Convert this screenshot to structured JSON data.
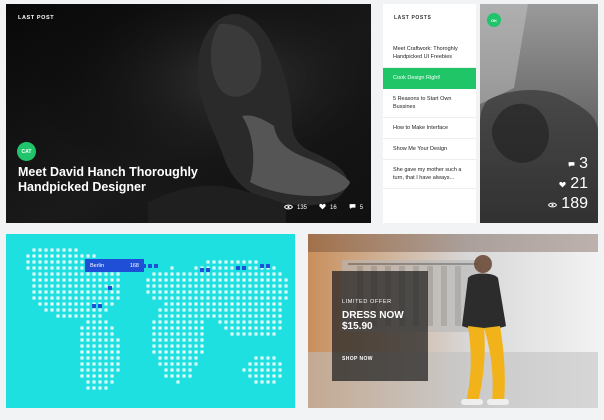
{
  "hero": {
    "kicker": "LAST POST",
    "category": "CAT",
    "title": "Meet David Hanch Thoroughly Handpicked Designer",
    "stats": {
      "views": "135",
      "likes": "16",
      "comments": "5"
    }
  },
  "last_posts": {
    "title": "LAST POSTS",
    "items": [
      {
        "label": "Meet Craftwork: Thoroghly Handpicked UI Freebies",
        "active": false
      },
      {
        "label": "Cook Design Right!",
        "active": true
      },
      {
        "label": "5 Reasons to Start Own Bussines",
        "active": false
      },
      {
        "label": "How to Make Interface",
        "active": false
      },
      {
        "label": "Show Me Your Design",
        "active": false
      },
      {
        "label": "She gave my mother such a turn, that I have always...",
        "active": false
      }
    ]
  },
  "side_card": {
    "badge": "OK",
    "stats": {
      "comments": "3",
      "likes": "21",
      "views": "189"
    }
  },
  "map": {
    "pin": {
      "city": "Berlin",
      "value": "168"
    }
  },
  "promo": {
    "kicker": "LIMITED OFFER",
    "title": "DRESS NOW $15.90",
    "cta": "SHOP NOW"
  },
  "colors": {
    "accent_green": "#20c46b",
    "map_bg": "#1fe0e0",
    "map_dot": "#ffffff",
    "map_pin": "#1f4fd6"
  }
}
